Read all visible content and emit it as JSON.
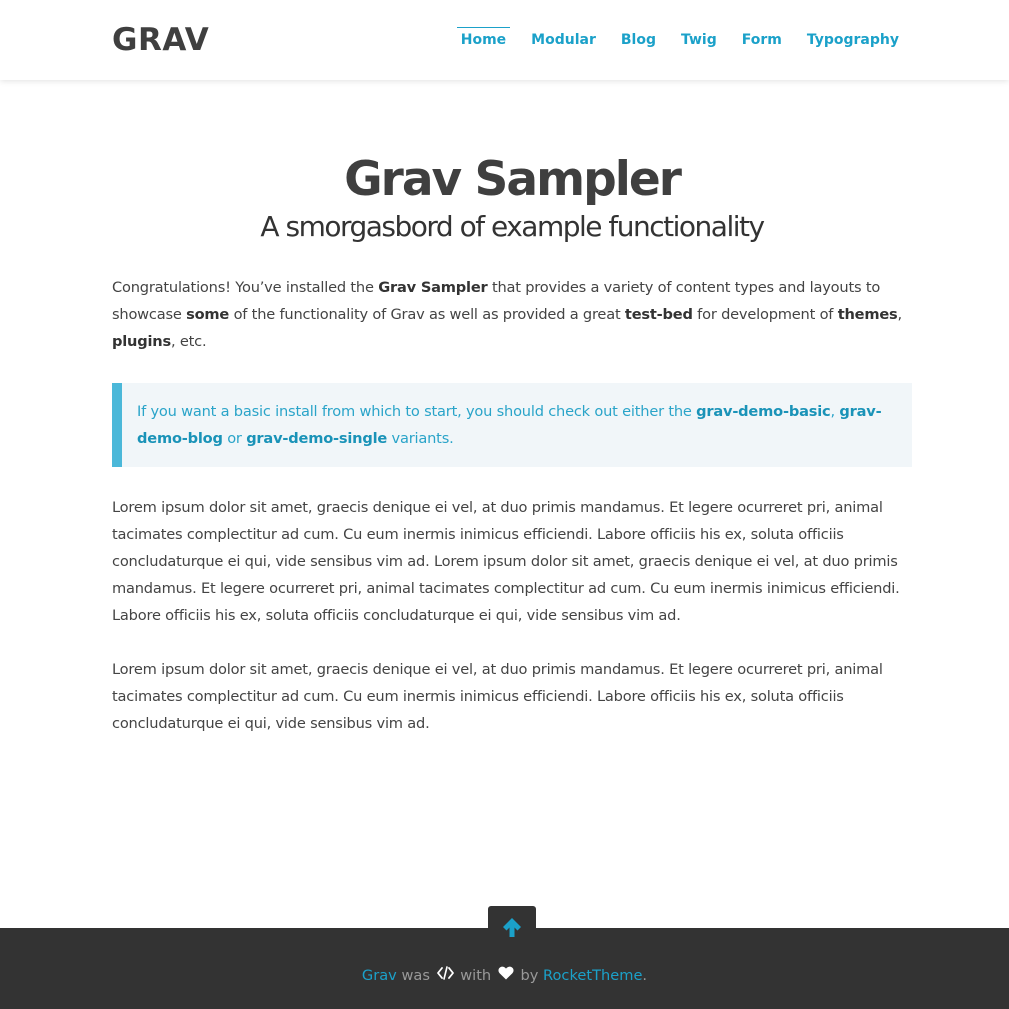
{
  "header": {
    "logo": "GRAV",
    "nav": [
      {
        "label": "Home",
        "active": true
      },
      {
        "label": "Modular"
      },
      {
        "label": "Blog"
      },
      {
        "label": "Twig"
      },
      {
        "label": "Form"
      },
      {
        "label": "Typography"
      }
    ]
  },
  "main": {
    "title": "Grav Sampler",
    "subtitle": "A smorgasbord of example functionality",
    "intro": {
      "t1": "Congratulations! You’ve installed the ",
      "b1": "Grav Sampler",
      "t2": " that provides a variety of content types and layouts to showcase ",
      "b2": "some",
      "t3": " of the functionality of Grav as well as provided a great ",
      "b3": "test-bed",
      "t4": " for development of ",
      "b4": "themes",
      "t5": ", ",
      "b5": "plugins",
      "t6": ", etc."
    },
    "notice": {
      "t1": "If you want a basic install from which to start, you should check out either the ",
      "link1": "grav-demo-basic",
      "t2": ", ",
      "link2": "grav-demo-blog",
      "t3": " or ",
      "link3": "grav-demo-single",
      "t4": " variants."
    },
    "paragraph1": "Lorem ipsum dolor sit amet, graecis denique ei vel, at duo primis mandamus. Et legere ocurreret pri, animal tacimates complectitur ad cum. Cu eum inermis inimicus efficiendi. Labore officiis his ex, soluta officiis concludaturque ei qui, vide sensibus vim ad. Lorem ipsum dolor sit amet, graecis denique ei vel, at duo primis mandamus. Et legere ocurreret pri, animal tacimates complectitur ad cum. Cu eum inermis inimicus efficiendi. Labore officiis his ex, soluta officiis concludaturque ei qui, vide sensibus vim ad.",
    "paragraph2": "Lorem ipsum dolor sit amet, graecis denique ei vel, at duo primis mandamus. Et legere ocurreret pri, animal tacimates complectitur ad cum. Cu eum inermis inimicus efficiendi. Labore officiis his ex, soluta officiis concludaturque ei qui, vide sensibus vim ad."
  },
  "footer": {
    "grav_link": "Grav",
    "was": " was ",
    "code_icon": "code-icon",
    "with": " with ",
    "heart_icon": "heart-icon",
    "by": " by ",
    "rockettheme_link": "RocketTheme",
    "period": ".",
    "to_top_icon": "arrow-up-icon"
  },
  "colors": {
    "accent": "#1ba1c9",
    "notice_border": "#4bb8d9",
    "notice_bg": "#f1f6f9",
    "footer_bg": "#333333"
  }
}
